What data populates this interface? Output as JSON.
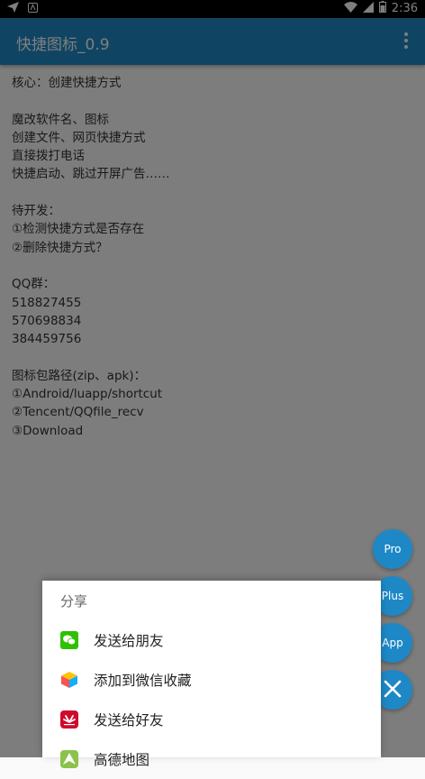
{
  "status_bar": {
    "time": "2:36"
  },
  "app_bar": {
    "title": "快捷图标_0.9"
  },
  "content_lines": [
    "核心：创建快捷方式",
    "",
    "魔改软件名、图标",
    "创建文件、网页快捷方式",
    "直接拨打电话",
    "快捷启动、跳过开屏广告……",
    "",
    "待开发：",
    "①检测快捷方式是否存在",
    "②删除快捷方式？",
    "",
    "QQ群：",
    "518827455",
    "570698834",
    "384459756",
    "",
    "图标包路径(zip、apk)：",
    "①Android/luapp/shortcut",
    "②Tencent/QQfile_recv",
    "③Download"
  ],
  "fabs": {
    "pro": "Pro",
    "plus": "Plus",
    "app": "App"
  },
  "share_sheet": {
    "title": "分享",
    "items": [
      {
        "label": "发送给朋友",
        "icon": "wechat-icon"
      },
      {
        "label": "添加到微信收藏",
        "icon": "wechat-favorites-icon"
      },
      {
        "label": "发送给好友",
        "icon": "huawei-icon"
      },
      {
        "label": "高德地图",
        "icon": "amap-icon"
      }
    ]
  },
  "colors": {
    "accent": "#1e88c7",
    "wechat": "#2dc100",
    "huawei": "#cf0a2c"
  }
}
